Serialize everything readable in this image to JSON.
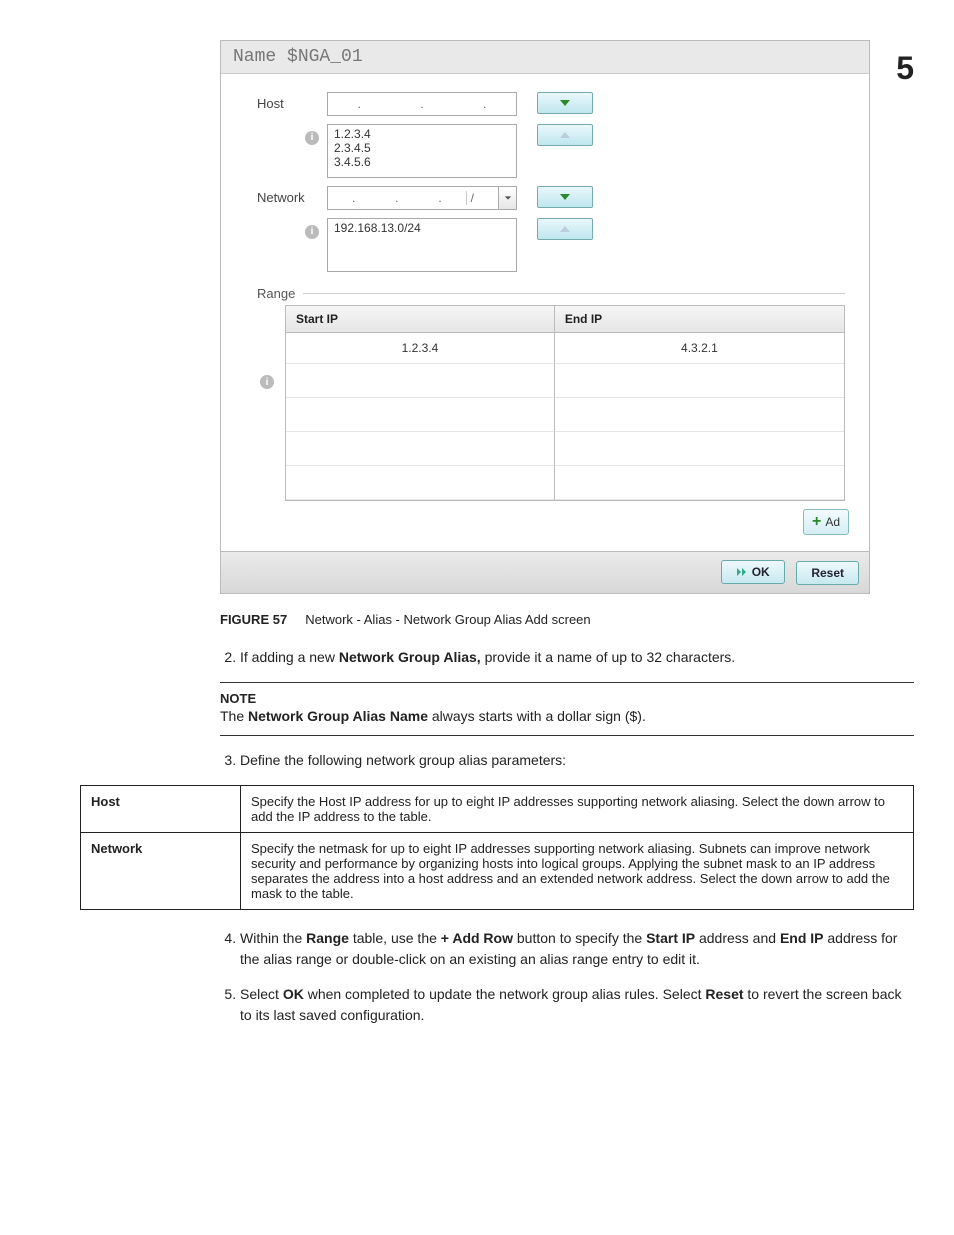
{
  "chapter_number": "5",
  "screenshot": {
    "title_label": "Name",
    "title_value": "$NGA_01",
    "host_label": "Host",
    "host_list": [
      "1.2.3.4",
      "2.3.4.5",
      "3.4.5.6"
    ],
    "network_label": "Network",
    "network_slash": "/",
    "network_list": [
      "192.168.13.0/24"
    ],
    "range_label": "Range",
    "range_headers": {
      "start": "Start IP",
      "end": "End IP"
    },
    "range_rows": [
      {
        "start": "1.2.3.4",
        "end": "4.3.2.1"
      }
    ],
    "addrow_label": "Ad",
    "ok_label": "OK",
    "reset_label": "Reset"
  },
  "figure_caption": {
    "label": "FIGURE 57",
    "text": "Network - Alias - Network Group Alias Add screen"
  },
  "step2": {
    "pre": "If adding a new ",
    "bold": "Network Group Alias,",
    "post": " provide it a name of up to 32 characters."
  },
  "note": {
    "head": "NOTE",
    "pre": "The ",
    "bold": "Network Group Alias Name",
    "post": " always starts with a dollar sign ($)."
  },
  "step3": "Define the following network group alias parameters:",
  "param_table": {
    "host_label": "Host",
    "host_text": "Specify the Host IP address for up to eight IP addresses supporting network aliasing. Select the down arrow to add the IP address to the table.",
    "network_label": "Network",
    "network_text": "Specify the netmask for up to eight IP addresses supporting network aliasing. Subnets can improve network security and performance by organizing hosts into logical groups. Applying the subnet mask to an IP address separates the address into a host address and an extended network address. Select the down arrow to add the mask to the table."
  },
  "step4": {
    "t1": "Within the ",
    "b1": "Range",
    "t2": " table, use the ",
    "b2": "+ Add Row",
    "t3": " button to specify the ",
    "b3": "Start IP",
    "t4": " address and ",
    "b4": "End IP",
    "t5": " address for the alias range or double-click on an existing an alias range entry to edit it."
  },
  "step5": {
    "t1": "Select ",
    "b1": "OK",
    "t2": " when completed to update the network group alias rules. Select ",
    "b2": "Reset",
    "t3": " to revert the screen back to its last saved configuration."
  }
}
